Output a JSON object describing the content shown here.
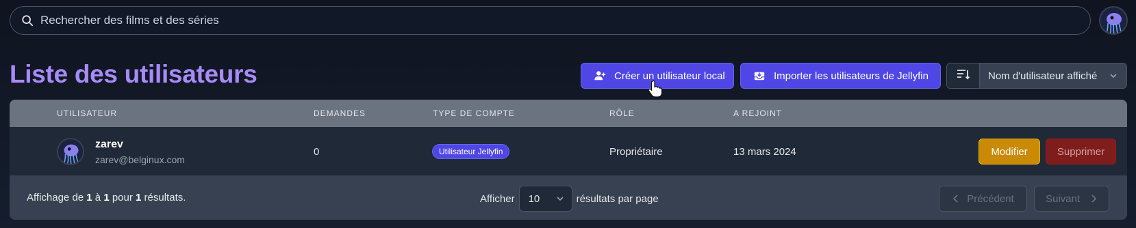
{
  "search": {
    "placeholder": "Rechercher des films et des séries"
  },
  "page": {
    "title": "Liste des utilisateurs"
  },
  "toolbar": {
    "create_label": "Créer un utilisateur local",
    "import_label": "Importer les utilisateurs de Jellyfin",
    "sort_value": "Nom d'utilisateur affiché"
  },
  "table": {
    "headers": [
      "UTILISATEUR",
      "DEMANDES",
      "TYPE DE COMPTE",
      "RÔLE",
      "A REJOINT"
    ],
    "rows": [
      {
        "name": "zarev",
        "email": "zarev@belginux.com",
        "requests": "0",
        "account_type": "Utilisateur Jellyfin",
        "role": "Propriétaire",
        "joined": "13 mars 2024",
        "edit_label": "Modifier",
        "delete_label": "Supprimer"
      }
    ]
  },
  "footer": {
    "showing_prefix": "Affichage de ",
    "showing_from": "1",
    "showing_mid1": " à ",
    "showing_to": "1",
    "showing_mid2": " pour ",
    "showing_total": "1",
    "showing_suffix": " résultats.",
    "show_label": "Afficher",
    "per_page": "10",
    "per_page_suffix": "résultats par page",
    "prev_label": "Précédent",
    "next_label": "Suivant"
  },
  "colors": {
    "accent": "#4f46e5",
    "title": "#a78bfa",
    "edit": "#ca8a04",
    "delete": "#7f1d1d"
  },
  "icons": [
    "search-icon",
    "user-avatar-icon",
    "user-plus-icon",
    "inbox-download-icon",
    "sort-icon",
    "chevron-down-icon",
    "chevron-left-icon",
    "chevron-right-icon",
    "hand-cursor-icon"
  ]
}
